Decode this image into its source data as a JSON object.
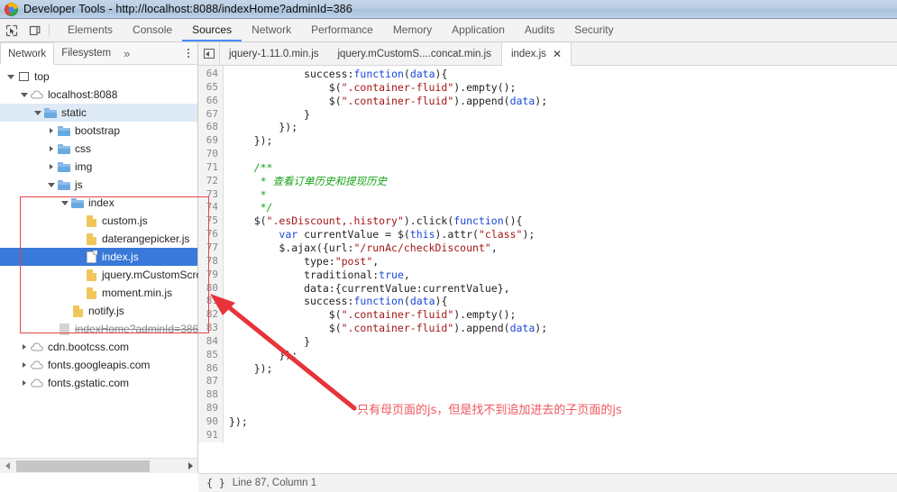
{
  "window": {
    "title": "Developer Tools - http://localhost:8088/indexHome?adminId=386",
    "logo_icon": "chrome-logo-icon"
  },
  "toolbar": {
    "inspect_icon": "inspect-element-icon",
    "device_icon": "device-toolbar-icon",
    "panels": [
      {
        "label": "Elements",
        "selected": false
      },
      {
        "label": "Console",
        "selected": false
      },
      {
        "label": "Sources",
        "selected": true
      },
      {
        "label": "Network",
        "selected": false
      },
      {
        "label": "Performance",
        "selected": false
      },
      {
        "label": "Memory",
        "selected": false
      },
      {
        "label": "Application",
        "selected": false
      },
      {
        "label": "Audits",
        "selected": false
      },
      {
        "label": "Security",
        "selected": false
      }
    ]
  },
  "navigator": {
    "subtabs": [
      {
        "label": "Network",
        "selected": true
      },
      {
        "label": "Filesystem",
        "selected": false
      },
      {
        "label": "»",
        "selected": false
      }
    ],
    "more_icon": "kebab-menu-icon",
    "tree": [
      {
        "label": "top",
        "indent": 0,
        "icon": "frame-icon",
        "twisty": "open",
        "state": "normal"
      },
      {
        "label": "localhost:8088",
        "indent": 1,
        "icon": "cloud-icon",
        "twisty": "open",
        "state": "normal"
      },
      {
        "label": "static",
        "indent": 2,
        "icon": "folder-icon",
        "twisty": "open",
        "state": "highlight"
      },
      {
        "label": "bootstrap",
        "indent": 3,
        "icon": "folder-icon",
        "twisty": "closed",
        "state": "normal"
      },
      {
        "label": "css",
        "indent": 3,
        "icon": "folder-icon",
        "twisty": "closed",
        "state": "normal"
      },
      {
        "label": "img",
        "indent": 3,
        "icon": "folder-icon",
        "twisty": "closed",
        "state": "normal"
      },
      {
        "label": "js",
        "indent": 3,
        "icon": "folder-icon",
        "twisty": "open",
        "state": "normal"
      },
      {
        "label": "index",
        "indent": 4,
        "icon": "folder-icon",
        "twisty": "open",
        "state": "normal"
      },
      {
        "label": "custom.js",
        "indent": 5,
        "icon": "js-file-icon",
        "twisty": "none",
        "state": "normal"
      },
      {
        "label": "daterangepicker.js",
        "indent": 5,
        "icon": "js-file-icon",
        "twisty": "none",
        "state": "normal"
      },
      {
        "label": "index.js",
        "indent": 5,
        "icon": "document-file-icon",
        "twisty": "none",
        "state": "selected"
      },
      {
        "label": "jquery.mCustomScrollb",
        "indent": 5,
        "icon": "js-file-icon",
        "twisty": "none",
        "state": "normal"
      },
      {
        "label": "moment.min.js",
        "indent": 5,
        "icon": "js-file-icon",
        "twisty": "none",
        "state": "normal"
      },
      {
        "label": "notify.js",
        "indent": 4,
        "icon": "js-file-icon",
        "twisty": "none",
        "state": "normal"
      },
      {
        "label": "indexHome?adminId=386",
        "indent": 3,
        "icon": "grey-file-icon",
        "twisty": "none",
        "state": "strikethrough"
      },
      {
        "label": "cdn.bootcss.com",
        "indent": 1,
        "icon": "cloud-icon",
        "twisty": "closed",
        "state": "normal"
      },
      {
        "label": "fonts.googleapis.com",
        "indent": 1,
        "icon": "cloud-icon",
        "twisty": "closed",
        "state": "normal"
      },
      {
        "label": "fonts.gstatic.com",
        "indent": 1,
        "icon": "cloud-icon",
        "twisty": "closed",
        "state": "normal"
      }
    ],
    "scrollbar": {
      "left_arrow_icon": "scroll-left-icon",
      "right_arrow_icon": "scroll-right-icon"
    }
  },
  "editor": {
    "collapse_icon": "collapse-sidebar-icon",
    "tabs": [
      {
        "label": "jquery-1.11.0.min.js",
        "active": false,
        "closable": false
      },
      {
        "label": "jquery.mCustomS....concat.min.js",
        "active": false,
        "closable": false
      },
      {
        "label": "index.js",
        "active": true,
        "closable": true,
        "close_label": "✕"
      }
    ],
    "first_line_number": 64,
    "last_line_number": 91,
    "lines": [
      {
        "n": 64,
        "tokens": [
          {
            "t": "            success:",
            "c": "pun"
          },
          {
            "t": "function",
            "c": "kw"
          },
          {
            "t": "(",
            "c": "pun"
          },
          {
            "t": "data",
            "c": "var"
          },
          {
            "t": "){",
            "c": "pun"
          }
        ]
      },
      {
        "n": 65,
        "tokens": [
          {
            "t": "                $(",
            "c": "pun"
          },
          {
            "t": "\".container-fluid\"",
            "c": "str"
          },
          {
            "t": ").empty();",
            "c": "pun"
          }
        ]
      },
      {
        "n": 66,
        "tokens": [
          {
            "t": "                $(",
            "c": "pun"
          },
          {
            "t": "\".container-fluid\"",
            "c": "str"
          },
          {
            "t": ").append(",
            "c": "pun"
          },
          {
            "t": "data",
            "c": "var"
          },
          {
            "t": ");",
            "c": "pun"
          }
        ]
      },
      {
        "n": 67,
        "tokens": [
          {
            "t": "            }",
            "c": "pun"
          }
        ]
      },
      {
        "n": 68,
        "tokens": [
          {
            "t": "        });",
            "c": "pun"
          }
        ]
      },
      {
        "n": 69,
        "tokens": [
          {
            "t": "    });",
            "c": "pun"
          }
        ]
      },
      {
        "n": 70,
        "tokens": [
          {
            "t": "",
            "c": "pun"
          }
        ]
      },
      {
        "n": 71,
        "tokens": [
          {
            "t": "    /**",
            "c": "cmt"
          }
        ]
      },
      {
        "n": 72,
        "tokens": [
          {
            "t": "     * 查看订单历史和提现历史",
            "c": "cmt"
          }
        ]
      },
      {
        "n": 73,
        "tokens": [
          {
            "t": "     *",
            "c": "cmt"
          }
        ]
      },
      {
        "n": 74,
        "tokens": [
          {
            "t": "     */",
            "c": "cmt"
          }
        ]
      },
      {
        "n": 75,
        "tokens": [
          {
            "t": "    $(",
            "c": "pun"
          },
          {
            "t": "\".esDiscount,.history\"",
            "c": "str"
          },
          {
            "t": ").click(",
            "c": "pun"
          },
          {
            "t": "function",
            "c": "kw"
          },
          {
            "t": "(){",
            "c": "pun"
          }
        ]
      },
      {
        "n": 76,
        "tokens": [
          {
            "t": "        ",
            "c": "pun"
          },
          {
            "t": "var",
            "c": "kw"
          },
          {
            "t": " currentValue = $(",
            "c": "pun"
          },
          {
            "t": "this",
            "c": "kw"
          },
          {
            "t": ").attr(",
            "c": "pun"
          },
          {
            "t": "\"class\"",
            "c": "str"
          },
          {
            "t": ");",
            "c": "pun"
          }
        ]
      },
      {
        "n": 77,
        "tokens": [
          {
            "t": "        $.ajax({url:",
            "c": "pun"
          },
          {
            "t": "\"/runAc/checkDiscount\"",
            "c": "str"
          },
          {
            "t": ",",
            "c": "pun"
          }
        ]
      },
      {
        "n": 78,
        "tokens": [
          {
            "t": "            type:",
            "c": "pun"
          },
          {
            "t": "\"post\"",
            "c": "str"
          },
          {
            "t": ",",
            "c": "pun"
          }
        ]
      },
      {
        "n": 79,
        "tokens": [
          {
            "t": "            traditional:",
            "c": "pun"
          },
          {
            "t": "true",
            "c": "kw"
          },
          {
            "t": ",",
            "c": "pun"
          }
        ]
      },
      {
        "n": 80,
        "tokens": [
          {
            "t": "            data:{currentValue:currentValue},",
            "c": "pun"
          }
        ]
      },
      {
        "n": 81,
        "tokens": [
          {
            "t": "            success:",
            "c": "pun"
          },
          {
            "t": "function",
            "c": "kw"
          },
          {
            "t": "(",
            "c": "pun"
          },
          {
            "t": "data",
            "c": "var"
          },
          {
            "t": "){",
            "c": "pun"
          }
        ]
      },
      {
        "n": 82,
        "tokens": [
          {
            "t": "                $(",
            "c": "pun"
          },
          {
            "t": "\".container-fluid\"",
            "c": "str"
          },
          {
            "t": ").empty();",
            "c": "pun"
          }
        ]
      },
      {
        "n": 83,
        "tokens": [
          {
            "t": "                $(",
            "c": "pun"
          },
          {
            "t": "\".container-fluid\"",
            "c": "str"
          },
          {
            "t": ").append(",
            "c": "pun"
          },
          {
            "t": "data",
            "c": "var"
          },
          {
            "t": ");",
            "c": "pun"
          }
        ]
      },
      {
        "n": 84,
        "tokens": [
          {
            "t": "            }",
            "c": "pun"
          }
        ]
      },
      {
        "n": 85,
        "tokens": [
          {
            "t": "        });",
            "c": "pun"
          }
        ]
      },
      {
        "n": 86,
        "tokens": [
          {
            "t": "    });",
            "c": "pun"
          }
        ]
      },
      {
        "n": 87,
        "tokens": [
          {
            "t": "",
            "c": "pun"
          }
        ]
      },
      {
        "n": 88,
        "tokens": [
          {
            "t": "",
            "c": "pun"
          }
        ]
      },
      {
        "n": 89,
        "tokens": [
          {
            "t": "",
            "c": "pun"
          }
        ]
      },
      {
        "n": 90,
        "tokens": [
          {
            "t": "});",
            "c": "pun"
          }
        ]
      },
      {
        "n": 91,
        "tokens": [
          {
            "t": "",
            "c": "pun"
          }
        ]
      }
    ]
  },
  "statusbar": {
    "format_icon": "{ }",
    "position": "Line 87, Column 1"
  },
  "annotations": {
    "rect_color": "#e8434a",
    "arrow_color": "#e8333a",
    "note_text": "只有母页面的js，但是找不到追加进去的子页面的js",
    "note_color": "#f0565c"
  }
}
